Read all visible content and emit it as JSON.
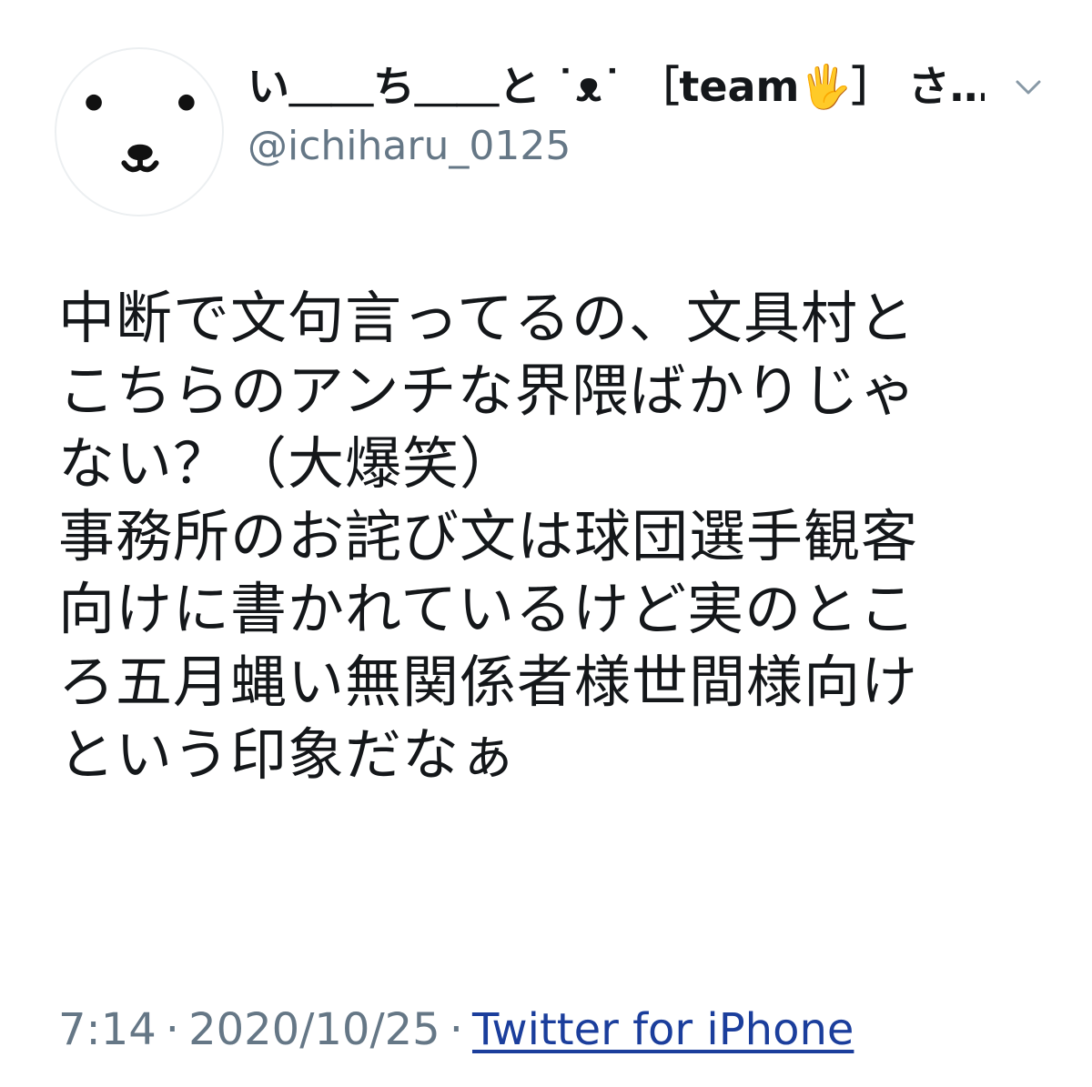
{
  "tweet": {
    "display_name": "い＿＿ち＿＿と ˙ᴥ˙ ［team🖐］ さ…",
    "screen_name": "@ichiharu_0125",
    "avatar_icon": "bear-face-icon",
    "menu_icon": "chevron-down-icon",
    "text_lines": [
      "中断で文句言ってるの、文具村と",
      "こちらのアンチな界隈ばかりじゃ",
      "ない？（大爆笑）",
      "事務所のお詫び文は球団選手観客",
      "向けに書かれているけど実のとこ",
      "ろ五月蝿い無関係者様世間様向け",
      "という印象だなぁ"
    ],
    "time": "7:14",
    "separator": "·",
    "date": "2020/10/25",
    "source": "Twitter for iPhone"
  },
  "colors": {
    "text": "#14171a",
    "secondary": "#657786",
    "link": "#1b3e9c"
  }
}
